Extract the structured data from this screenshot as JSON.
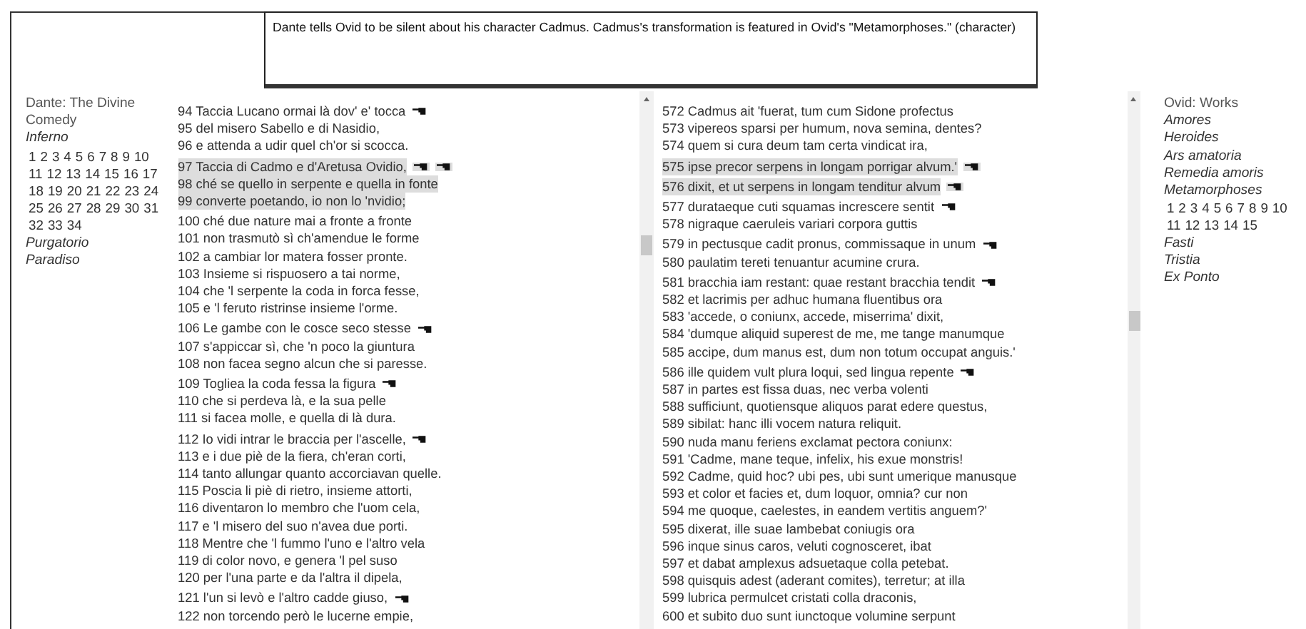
{
  "tooltip": {
    "text": "Dante tells Ovid to be silent about his character Cadmus. Cadmus's transformation is featured in Ovid's \"Metamorphoses.\" (character)"
  },
  "dante_nav": {
    "title": "Dante: The Divine Comedy",
    "sections": [
      {
        "label": "Inferno",
        "cantos": [
          "1",
          "2",
          "3",
          "4",
          "5",
          "6",
          "7",
          "8",
          "9",
          "10",
          "11",
          "12",
          "13",
          "14",
          "15",
          "16",
          "17",
          "18",
          "19",
          "20",
          "21",
          "22",
          "23",
          "24",
          "25",
          "26",
          "27",
          "28",
          "29",
          "30",
          "31",
          "32",
          "33",
          "34"
        ]
      },
      {
        "label": "Purgatorio"
      },
      {
        "label": "Paradiso"
      }
    ]
  },
  "italian_text": {
    "passages": [
      {
        "highlighted": false,
        "lines": [
          {
            "text": "94 Taccia Lucano ormai là dov' e' tocca",
            "notes": [
              {
                "kind": "hand"
              }
            ]
          },
          {
            "text": "95 del misero Sabello e di Nasidio,"
          },
          {
            "text": "96 e attenda a udir quel ch'or si scocca."
          }
        ]
      },
      {
        "highlighted": true,
        "lines": [
          {
            "text": "97 Taccia di Cadmo e d'Aretusa Ovidio,",
            "notes": [
              {
                "kind": "hand"
              },
              {
                "kind": "hand"
              }
            ]
          },
          {
            "text": "98 ché se quello in serpente e quella in fonte"
          },
          {
            "text": "99 converte poetando, io non lo 'nvidio;"
          }
        ]
      },
      {
        "highlighted": false,
        "lines": [
          {
            "text": "100 ché due nature mai a fronte a fronte"
          },
          {
            "text": "101 non trasmutò sì ch'amendue le forme"
          },
          {
            "text": "102 a cambiar lor matera fosser pronte."
          },
          {
            "text": "103 Insieme si rispuosero a tai norme,"
          },
          {
            "text": "104 che 'l serpente la coda in forca fesse,"
          },
          {
            "text": "105 e 'l feruto ristrinse insieme l'orme."
          }
        ]
      },
      {
        "highlighted": false,
        "lines": [
          {
            "text": "106 Le gambe con le cosce seco stesse",
            "notes": [
              {
                "kind": "hand"
              }
            ]
          },
          {
            "text": "107 s'appiccar sì, che 'n poco la giuntura"
          },
          {
            "text": "108 non facea segno alcun che si paresse."
          }
        ]
      },
      {
        "highlighted": false,
        "lines": [
          {
            "text": "109 Togliea la coda fessa la figura",
            "notes": [
              {
                "kind": "hand"
              }
            ]
          },
          {
            "text": "110 che si perdeva là, e la sua pelle"
          },
          {
            "text": "111 si facea molle, e quella di là dura."
          }
        ]
      },
      {
        "highlighted": false,
        "lines": [
          {
            "text": "112 Io vidi intrar le braccia per l'ascelle,",
            "notes": [
              {
                "kind": "hand"
              }
            ]
          },
          {
            "text": "113 e i due piè de la fiera, ch'eran corti,"
          },
          {
            "text": "114 tanto allungar quanto accorciavan quelle."
          },
          {
            "text": "115 Poscia li piè di rietro, insieme attorti,"
          },
          {
            "text": "116 diventaron lo membro che l'uom cela,"
          },
          {
            "text": "117 e 'l misero del suo n'avea due porti."
          },
          {
            "text": "118 Mentre che 'l fummo l'uno e l'altro vela"
          },
          {
            "text": "119 di color novo, e genera 'l pel suso"
          },
          {
            "text": "120 per l'una parte e da l'altra il dipela,"
          }
        ]
      },
      {
        "highlighted": false,
        "lines": [
          {
            "text": "121 l'un si levò e l'altro cadde giuso,",
            "notes": [
              {
                "kind": "hand"
              }
            ]
          },
          {
            "text": "122 non torcendo però le lucerne empie,"
          }
        ]
      }
    ]
  },
  "latin_text": {
    "passages": [
      {
        "highlighted": false,
        "lines": [
          {
            "text": "572 Cadmus ait 'fuerat, tum cum Sidone profectus"
          },
          {
            "text": "573 vipereos sparsi per humum, nova semina, dentes?"
          },
          {
            "text": "574 quem si cura deum tam certa vindicat ira,"
          }
        ]
      },
      {
        "highlighted": true,
        "lines": [
          {
            "text": "575 ipse precor serpens in longam porrigar alvum.'",
            "notes": [
              {
                "kind": "hand"
              }
            ]
          }
        ]
      },
      {
        "highlighted": true,
        "lines": [
          {
            "text": "576 dixit, et ut serpens in longam tenditur alvum",
            "notes": [
              {
                "kind": "hand"
              }
            ]
          }
        ]
      },
      {
        "highlighted": false,
        "lines": [
          {
            "text": "577 durataeque cuti squamas increscere sentit",
            "notes": [
              {
                "kind": "hand"
              }
            ]
          },
          {
            "text": "578 nigraque caeruleis variari corpora guttis"
          }
        ]
      },
      {
        "highlighted": false,
        "lines": [
          {
            "text": "579 in pectusque cadit pronus, commissaque in unum",
            "notes": [
              {
                "kind": "hand"
              }
            ]
          },
          {
            "text": "580 paulatim tereti tenuantur acumine crura."
          }
        ]
      },
      {
        "highlighted": false,
        "lines": [
          {
            "text": "581 bracchia iam restant: quae restant bracchia tendit",
            "notes": [
              {
                "kind": "hand"
              }
            ]
          },
          {
            "text": "582 et lacrimis per adhuc humana fluentibus ora"
          },
          {
            "text": "583 'accede, o coniunx, accede, miserrima' dixit,"
          },
          {
            "text": "584 'dumque aliquid superest de me, me tange manumque"
          },
          {
            "text": "585 accipe, dum manus est, dum non totum occupat anguis.'"
          }
        ]
      },
      {
        "highlighted": false,
        "lines": [
          {
            "text": "586 ille quidem vult plura loqui, sed lingua repente",
            "notes": [
              {
                "kind": "hand"
              }
            ]
          },
          {
            "text": "587 in partes est fissa duas, nec verba volenti"
          },
          {
            "text": "588 sufficiunt, quotiensque aliquos parat edere questus,"
          },
          {
            "text": "589 sibilat: hanc illi vocem natura reliquit."
          },
          {
            "text": "590 nuda manu feriens exclamat pectora coniunx:"
          },
          {
            "text": "591 'Cadme, mane teque, infelix, his exue monstris!"
          },
          {
            "text": "592 Cadme, quid hoc? ubi pes, ubi sunt umerique manusque"
          },
          {
            "text": "593 et color et facies et, dum loquor, omnia? cur non"
          },
          {
            "text": "594 me quoque, caelestes, in eandem vertitis anguem?'"
          },
          {
            "text": "595 dixerat, ille suae lambebat coniugis ora"
          },
          {
            "text": "596 inque sinus caros, veluti cognosceret, ibat"
          },
          {
            "text": "597 et dabat amplexus adsuetaque colla petebat."
          },
          {
            "text": "598 quisquis adest (aderant comites), terretur; at illa"
          },
          {
            "text": "599 lubrica permulcet cristati colla draconis,"
          },
          {
            "text": "600 et subito duo sunt iunctoque volumine serpunt"
          }
        ]
      }
    ]
  },
  "ovid_nav": {
    "title": "Ovid: Works",
    "works": [
      {
        "label": "Amores"
      },
      {
        "label": "Heroides"
      },
      {
        "label": "Ars amatoria"
      },
      {
        "label": "Remedia amoris"
      },
      {
        "label": "Metamorphoses",
        "books": [
          "1",
          "2",
          "3",
          "4",
          "5",
          "6",
          "7",
          "8",
          "9",
          "10",
          "11",
          "12",
          "13",
          "14",
          "15"
        ]
      },
      {
        "label": "Fasti"
      },
      {
        "label": "Tristia"
      },
      {
        "label": "Ex Ponto"
      }
    ]
  }
}
